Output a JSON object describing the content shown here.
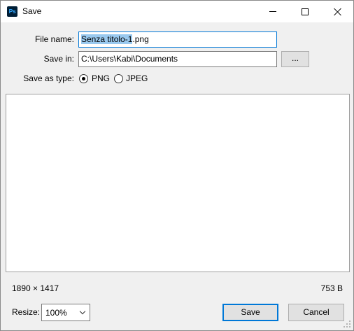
{
  "window": {
    "app_icon_text": "Ps",
    "title": "Save",
    "app_icon_color": "#001e36",
    "app_icon_text_color": "#31a8ff"
  },
  "form": {
    "file_name_label": "File name:",
    "file_name_selected": "Senza titolo-1",
    "file_name_rest": ".png",
    "save_in_label": "Save in:",
    "save_in_value": "C:\\Users\\Kabi\\Documents",
    "browse_label": "...",
    "save_as_type_label": "Save as type:",
    "types": [
      {
        "label": "PNG",
        "checked": true
      },
      {
        "label": "JPEG",
        "checked": false
      }
    ]
  },
  "info": {
    "dimensions": "1890 × 1417",
    "file_size": "753 B"
  },
  "footer": {
    "resize_label": "Resize:",
    "resize_value": "100%",
    "save_label": "Save",
    "cancel_label": "Cancel"
  },
  "colors": {
    "focus_accent": "#0078d7",
    "selection": "#99c9ef"
  }
}
